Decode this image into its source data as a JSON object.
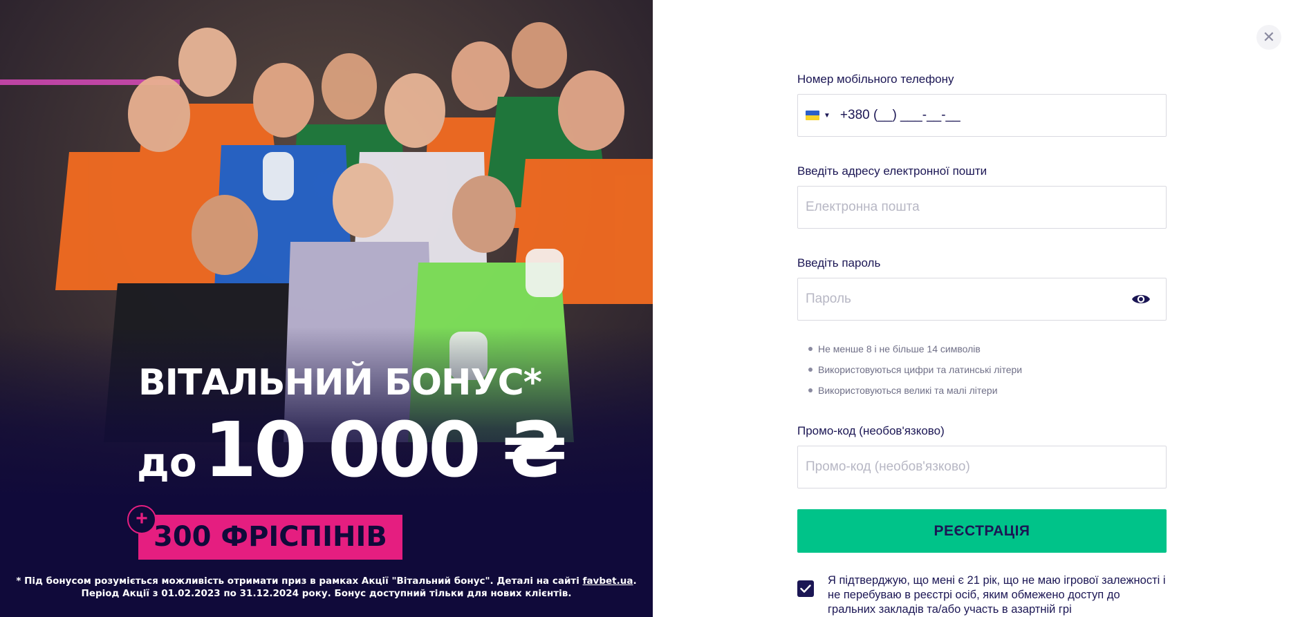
{
  "promo": {
    "title": "ВІТАЛЬНИЙ БОНУС*",
    "amount_prefix": "до",
    "amount": "10 000 ₴",
    "plus_symbol": "+",
    "spins": "300 ФРІСПІНІВ",
    "disclaimer_line1_prefix": "* Під бонусом розуміється можливість отримати приз в рамках Акції \"Вітальний бонус\". Деталі на сайті ",
    "disclaimer_link": "favbet.ua",
    "disclaimer_line1_suffix": ".",
    "disclaimer_line2": "Період Акції з 01.02.2023 по 31.12.2024 року. Бонус доступний тільки для нових клієнтів.",
    "colors": {
      "background": "#100a3a",
      "accent": "#e51e80",
      "kit_orange": "#f26b21"
    }
  },
  "close_button": {
    "symbol": "✕",
    "icon": "close-icon"
  },
  "form": {
    "phone": {
      "label": "Номер мобільного телефону",
      "country_flag": "ukraine-flag-icon",
      "value": "+380 (__) ___-__-__"
    },
    "email": {
      "label": "Введіть адресу електронної пошти",
      "placeholder": "Електронна пошта"
    },
    "password": {
      "label": "Введіть пароль",
      "placeholder": "Пароль",
      "toggle_icon": "eye-icon"
    },
    "password_rules": [
      "Не менше 8 і не більше 14 символів",
      "Використовуються цифри та латинські літери",
      "Використовуються великі та малі літери"
    ],
    "promo_code": {
      "label": "Промо-код (необов'язково)",
      "placeholder": "Промо-код (необов'язково)"
    },
    "submit_label": "РЕЄСТРАЦІЯ",
    "confirm": {
      "checked": true,
      "text": "Я підтверджую, що мені є 21 рік, що не маю ігрової залежності і не перебуваю в реєстрі осіб, яким обмежено доступ до гральних закладів та/або участь в азартній грі"
    },
    "colors": {
      "submit": "#00c389",
      "text": "#1b1654",
      "border": "#d9d9e0"
    }
  }
}
